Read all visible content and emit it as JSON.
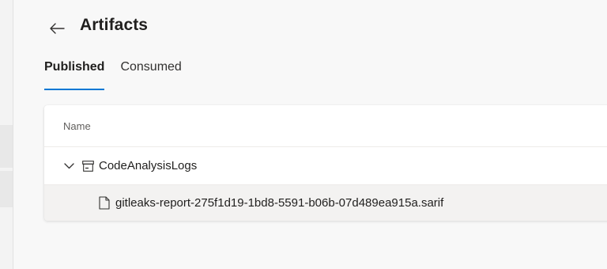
{
  "header": {
    "back_icon": "arrow-left-icon",
    "title": "Artifacts"
  },
  "tabs": [
    {
      "label": "Published",
      "active": true
    },
    {
      "label": "Consumed",
      "active": false
    }
  ],
  "table": {
    "column_header": "Name",
    "rows": [
      {
        "type": "folder",
        "label": "CodeAnalysisLogs",
        "icon": "chevron-down-icon",
        "expanded": true
      },
      {
        "type": "file",
        "label": "gitleaks-report-275f1d19-1bd8-5591-b06b-07d489ea915a.sarif",
        "icon": "file-icon"
      }
    ]
  },
  "colors": {
    "accent": "#0078d4",
    "page_bg": "#f8f8f8",
    "card_bg": "#ffffff",
    "selected_row_bg": "#f3f2f1"
  }
}
